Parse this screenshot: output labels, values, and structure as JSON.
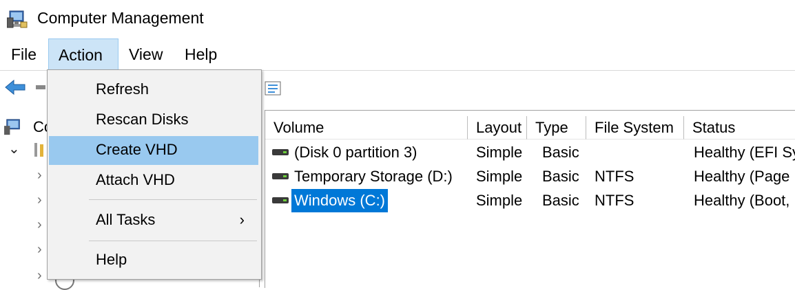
{
  "window": {
    "title": "Computer Management",
    "icon": "computer-management-icon"
  },
  "menubar": {
    "items": [
      "File",
      "Action",
      "View",
      "Help"
    ],
    "open_menu": "Action"
  },
  "toolbar": {
    "icons": [
      "back-arrow-icon",
      "forward-arrow-icon",
      "properties-icon"
    ]
  },
  "tree": {
    "root_label_partial": "Co"
  },
  "action_menu": {
    "items": [
      {
        "label": "Refresh"
      },
      {
        "label": "Rescan Disks"
      },
      {
        "label": "Create VHD",
        "highlighted": true
      },
      {
        "label": "Attach VHD"
      },
      {
        "label": "All Tasks",
        "submenu": true
      },
      {
        "label": "Help"
      }
    ],
    "submenu_arrow": "›"
  },
  "volume_list": {
    "columns": [
      "Volume",
      "Layout",
      "Type",
      "File System",
      "Status"
    ],
    "rows": [
      {
        "volume": "(Disk 0 partition 3)",
        "layout": "Simple",
        "type": "Basic",
        "fs": "",
        "status": "Healthy (EFI Sy"
      },
      {
        "volume": "Temporary Storage (D:)",
        "layout": "Simple",
        "type": "Basic",
        "fs": "NTFS",
        "status": "Healthy (Page"
      },
      {
        "volume": "Windows (C:)",
        "layout": "Simple",
        "type": "Basic",
        "fs": "NTFS",
        "status": "Healthy (Boot,",
        "selected": true
      }
    ]
  },
  "colors": {
    "selection": "#0078d7",
    "menu_highlight": "#99c9ef",
    "menu_open": "#cce4f7"
  }
}
